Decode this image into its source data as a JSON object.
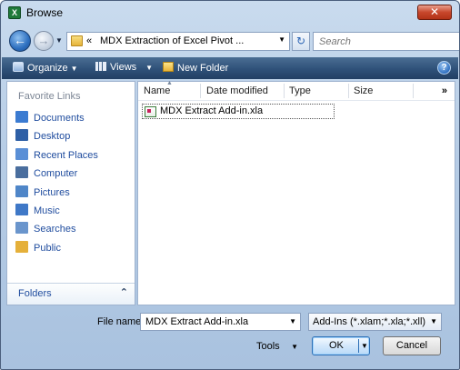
{
  "window": {
    "title": "Browse",
    "app_icon_glyph": "X",
    "close_glyph": "✕"
  },
  "address": {
    "path_chevron": "«",
    "path_text": "MDX Extraction of Excel Pivot ...",
    "search_placeholder": "Search"
  },
  "toolbar": {
    "organize_label": "Organize",
    "views_label": "Views",
    "new_folder_label": "New Folder",
    "help_glyph": "?"
  },
  "nav": {
    "header": "Favorite Links",
    "items": [
      {
        "label": "Documents",
        "icon": "documents-icon",
        "color": "#3b7bd1"
      },
      {
        "label": "Desktop",
        "icon": "desktop-icon",
        "color": "#2e5fa6"
      },
      {
        "label": "Recent Places",
        "icon": "recent-places-icon",
        "color": "#5a8fd6"
      },
      {
        "label": "Computer",
        "icon": "computer-icon",
        "color": "#4a6e9e"
      },
      {
        "label": "Pictures",
        "icon": "pictures-icon",
        "color": "#4f86c8"
      },
      {
        "label": "Music",
        "icon": "music-icon",
        "color": "#3f78c7"
      },
      {
        "label": "Searches",
        "icon": "searches-icon",
        "color": "#6a95cc"
      },
      {
        "label": "Public",
        "icon": "public-folder-icon",
        "color": "#e5b03a"
      }
    ],
    "folders_label": "Folders"
  },
  "files": {
    "columns": [
      "Name",
      "Date modified",
      "Type",
      "Size"
    ],
    "more_columns": "»",
    "rows": [
      {
        "name": "MDX Extract Add-in.xla"
      }
    ]
  },
  "footer": {
    "file_name_label": "File name:",
    "file_name_value": "MDX Extract Add-in.xla",
    "file_type_value": "Add-Ins (*.xlam;*.xla;*.xll)",
    "tools_label": "Tools",
    "ok_label": "OK",
    "cancel_label": "Cancel"
  }
}
